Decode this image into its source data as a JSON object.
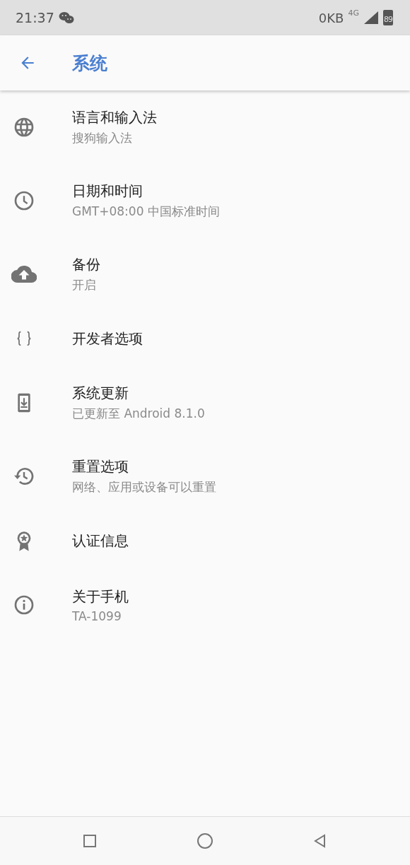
{
  "status_bar": {
    "time": "21:37",
    "data_rate": "0KB",
    "network": "4G",
    "battery": "89"
  },
  "header": {
    "title": "系统"
  },
  "items": [
    {
      "kind": "globe",
      "title": "语言和输入法",
      "subtitle": "搜狗输入法"
    },
    {
      "kind": "clock",
      "title": "日期和时间",
      "subtitle": "GMT+08:00 中国标准时间"
    },
    {
      "kind": "cloud",
      "title": "备份",
      "subtitle": "开启"
    },
    {
      "kind": "braces",
      "title": "开发者选项"
    },
    {
      "kind": "phone",
      "title": "系统更新",
      "subtitle": "已更新至 Android 8.1.0"
    },
    {
      "kind": "history",
      "title": "重置选项",
      "subtitle": "网络、应用或设备可以重置"
    },
    {
      "kind": "award",
      "title": "认证信息"
    },
    {
      "kind": "info",
      "title": "关于手机",
      "subtitle": "TA-1099"
    }
  ]
}
